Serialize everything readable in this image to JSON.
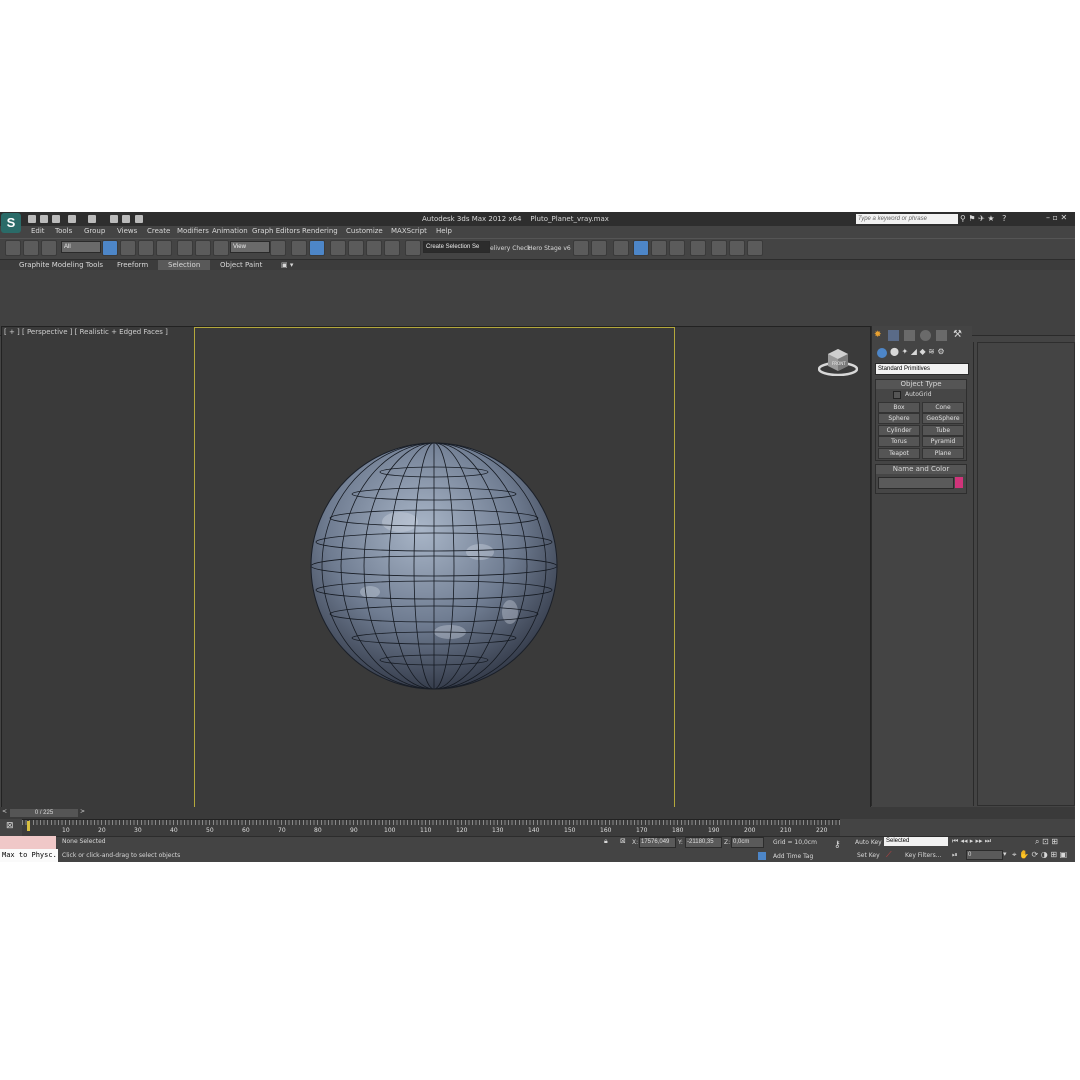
{
  "window": {
    "app_title": "Autodesk 3ds Max  2012 x64",
    "file_name": "Pluto_Planet_vray.max",
    "search_placeholder": "Type a keyword or phrase"
  },
  "menu": [
    "Edit",
    "Tools",
    "Group",
    "Views",
    "Create",
    "Modifiers",
    "Animation",
    "Graph Editors",
    "Rendering",
    "Customize",
    "MAXScript",
    "Help"
  ],
  "toolbar": {
    "filter_value": "All",
    "coord_value": "View",
    "selection_set_value": "Create Selection Se",
    "delivery_label": "elivery Check",
    "hero_label": "Hero Stage v6"
  },
  "ribbon_tabs": [
    "Graphite Modeling Tools",
    "Freeform",
    "Selection",
    "Object Paint"
  ],
  "viewport": {
    "label": "[ + ] [ Perspective ] [ Realistic + Edged Faces ]",
    "viewcube_label": "FRONT"
  },
  "command_panel": {
    "category": "Standard Primitives",
    "object_type_title": "Object Type",
    "autogrid_label": "AutoGrid",
    "buttons": [
      "Box",
      "Cone",
      "Sphere",
      "GeoSphere",
      "Cylinder",
      "Tube",
      "Torus",
      "Pyramid",
      "Teapot",
      "Plane"
    ],
    "name_color_title": "Name and Color",
    "swatch_color": "#d0347a"
  },
  "timeline": {
    "frame_display": "0 / 225",
    "ticks": [
      "10",
      "20",
      "30",
      "40",
      "50",
      "60",
      "70",
      "80",
      "90",
      "100",
      "110",
      "120",
      "130",
      "140",
      "150",
      "160",
      "170",
      "180",
      "190",
      "200",
      "210",
      "220"
    ]
  },
  "status": {
    "maxscript_label": "Max to Physc.",
    "selection_status": "None Selected",
    "prompt": "Click or click-and-drag to select objects",
    "x_label": "X:",
    "x_value": "17576,049",
    "y_label": "Y:",
    "y_value": "-21180,35",
    "z_label": "Z:",
    "z_value": "0,0cm",
    "grid": "Grid = 10,0cm",
    "add_time_tag": "Add Time Tag",
    "auto_key": "Auto Key",
    "set_key": "Set Key",
    "selected_value": "Selected",
    "key_filters": "Key Filters...",
    "frame_value": "0"
  },
  "colors": {
    "viewport_bg": "#3a3a3a",
    "safe_frame": "#b4a83c",
    "accent_blue": "#4d86c8"
  }
}
